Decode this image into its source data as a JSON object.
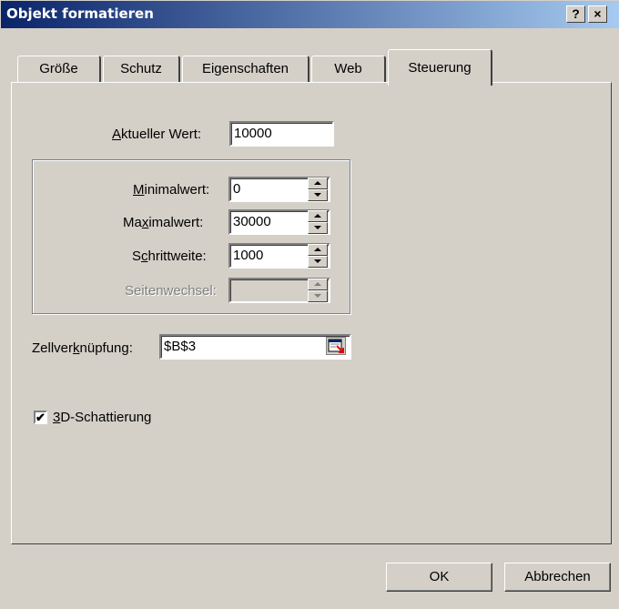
{
  "window": {
    "title": "Objekt formatieren",
    "help_label": "?",
    "close_label": "×"
  },
  "tabs": [
    {
      "label": "Größe"
    },
    {
      "label": "Schutz"
    },
    {
      "label": "Eigenschaften"
    },
    {
      "label": "Web"
    },
    {
      "label": "Steuerung",
      "active": true
    }
  ],
  "control": {
    "current_value": {
      "label_accel": "A",
      "label_rest": "ktueller Wert:",
      "value": "10000"
    },
    "min_value": {
      "label_accel": "M",
      "label_rest": "inimalwert:",
      "value": "0"
    },
    "max_value": {
      "label_pre": "Ma",
      "label_accel": "x",
      "label_rest": "imalwert:",
      "value": "30000"
    },
    "step": {
      "label_pre": "S",
      "label_accel": "c",
      "label_rest": "hrittweite:",
      "value": "1000"
    },
    "page_change": {
      "label": "Seitenwechsel:",
      "value": ""
    },
    "cell_link": {
      "label_pre": "Zellver",
      "label_accel": "k",
      "label_rest": "nüpfung:",
      "value": "$B$3"
    },
    "shading": {
      "label_accel": "3",
      "label_rest": "D-Schattierung",
      "checked": true,
      "check_mark": "✔"
    }
  },
  "buttons": {
    "ok": "OK",
    "cancel": "Abbrechen"
  }
}
